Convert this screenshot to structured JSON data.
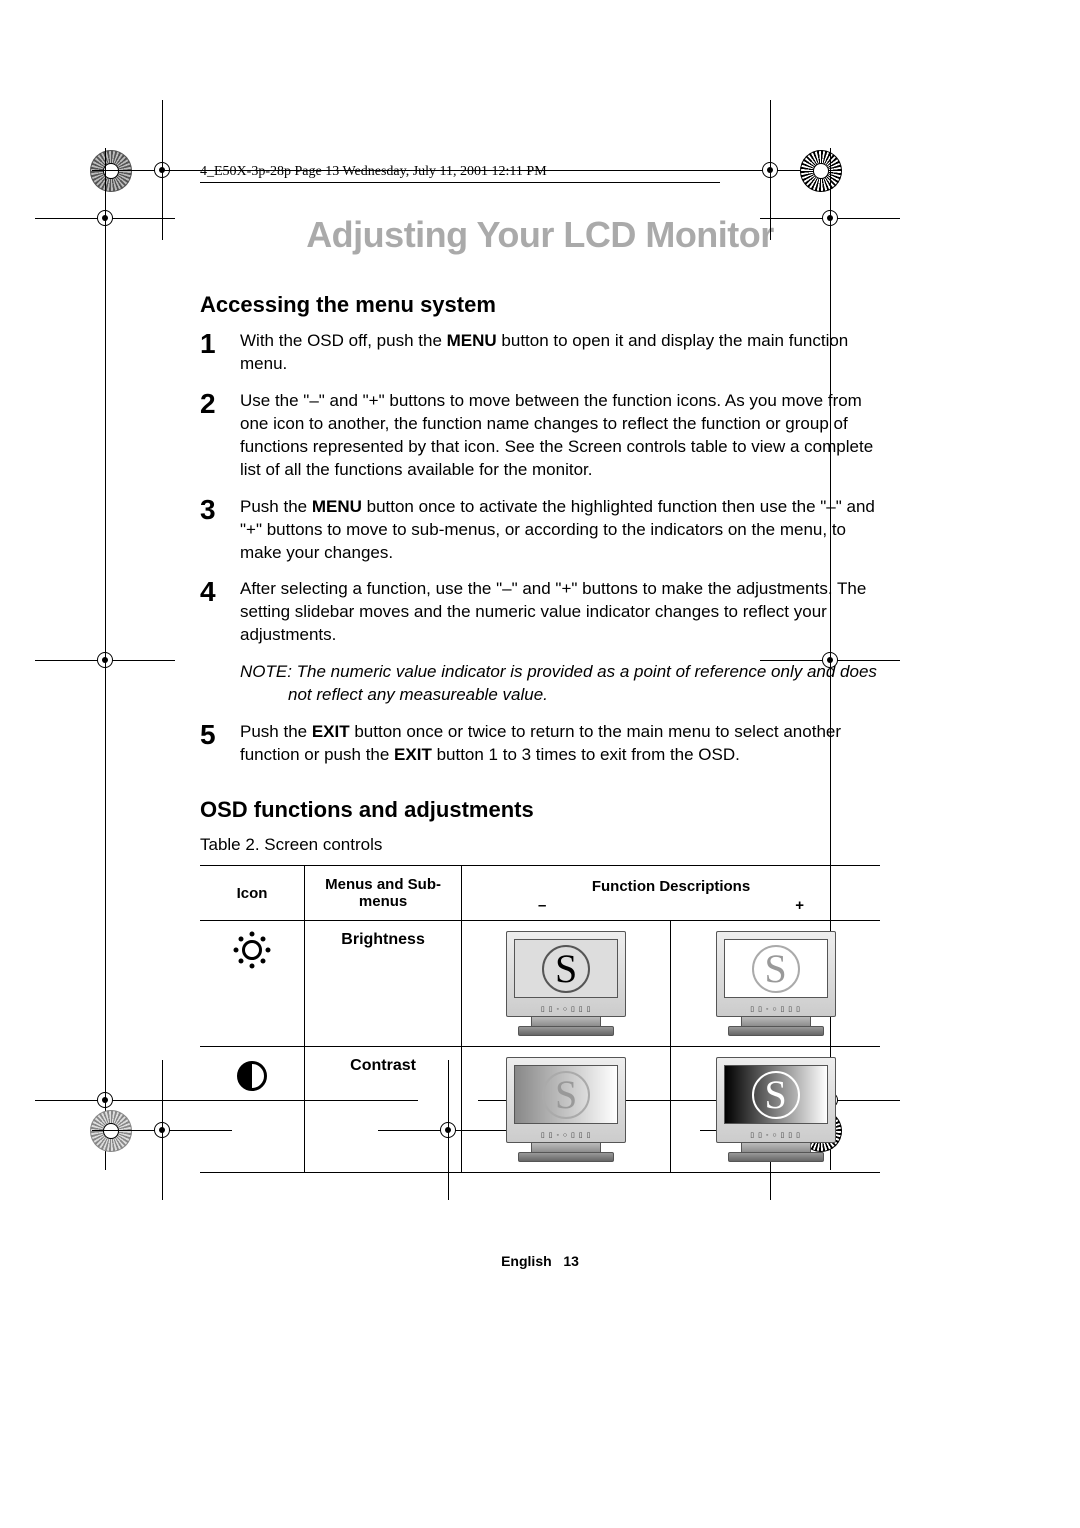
{
  "print_meta": "4_E50X-3p-28p  Page 13  Wednesday, July 11, 2001  12:11 PM",
  "chapter_title": "Adjusting Your LCD Monitor",
  "section1_heading": "Accessing the menu system",
  "steps": {
    "s1": {
      "num": "1",
      "text_before": "With the OSD off, push the ",
      "bold1": "MENU",
      "text_after": " button to open it and display the main function menu."
    },
    "s2": {
      "num": "2",
      "text": "Use the \"–\" and \"+\" buttons to move between the function icons. As you move from one icon to another, the function name changes to reflect the function or group of functions represented by that icon. See the Screen controls table to view a complete list of all the functions available for the monitor."
    },
    "s3": {
      "num": "3",
      "text_before": "Push the ",
      "bold1": "MENU",
      "text_after": " button once to activate the highlighted function then use the \"–\" and \"+\" buttons to move to sub-menus, or according to the indicators on the menu, to make your changes."
    },
    "s4": {
      "num": "4",
      "text": "After selecting a function, use the \"–\" and \"+\" buttons to make the adjustments. The setting slidebar moves and the numeric value indicator changes to reflect your adjustments."
    },
    "note_line1": "NOTE: The numeric value indicator is provided as a point of reference only and does",
    "note_line2": "not reflect any measureable value.",
    "s5": {
      "num": "5",
      "text_before": "Push the ",
      "bold1": "EXIT",
      "text_mid": " button once or twice to return to the main menu to select another function or push the ",
      "bold2": "EXIT",
      "text_after": " button 1 to 3 times to exit from the OSD."
    }
  },
  "section2_heading": "OSD functions and adjustments",
  "table_caption": "Table 2.  Screen controls",
  "table": {
    "headers": {
      "icon": "Icon",
      "menus": "Menus and Sub-menus",
      "fd": "Function Descriptions",
      "minus": "–",
      "plus": "+"
    },
    "rows": [
      {
        "menu": "Brightness"
      },
      {
        "menu": "Contrast"
      }
    ]
  },
  "footer": {
    "lang": "English",
    "page": "13"
  }
}
